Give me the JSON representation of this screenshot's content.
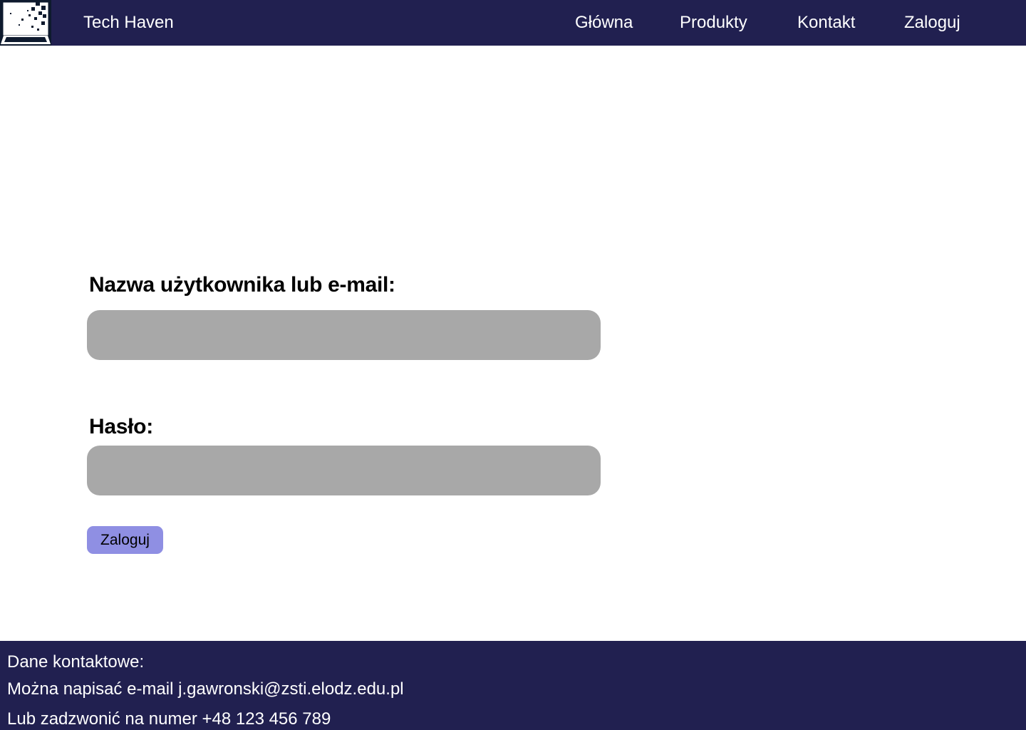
{
  "header": {
    "logo_icon": "laptop-pixel-logo-icon",
    "brand": "Tech Haven",
    "nav": {
      "home": "Główna",
      "products": "Produkty",
      "contact": "Kontakt",
      "login": "Zaloguj"
    }
  },
  "form": {
    "username_label": "Nazwa użytkownika lub e-mail:",
    "username_value": "",
    "password_label": "Hasło:",
    "password_value": "",
    "submit_label": "Zaloguj"
  },
  "footer": {
    "title": "Dane kontaktowe:",
    "email_line": "Można napisać e-mail j.gawronski@zsti.elodz.edu.pl",
    "phone_line": "Lub zadzwonić na numer +48 123 456 789"
  },
  "colors": {
    "bar_background": "#212050",
    "input_background": "#a8a8a8",
    "button_background": "#8f8fe3",
    "text_light": "#ffffff"
  }
}
